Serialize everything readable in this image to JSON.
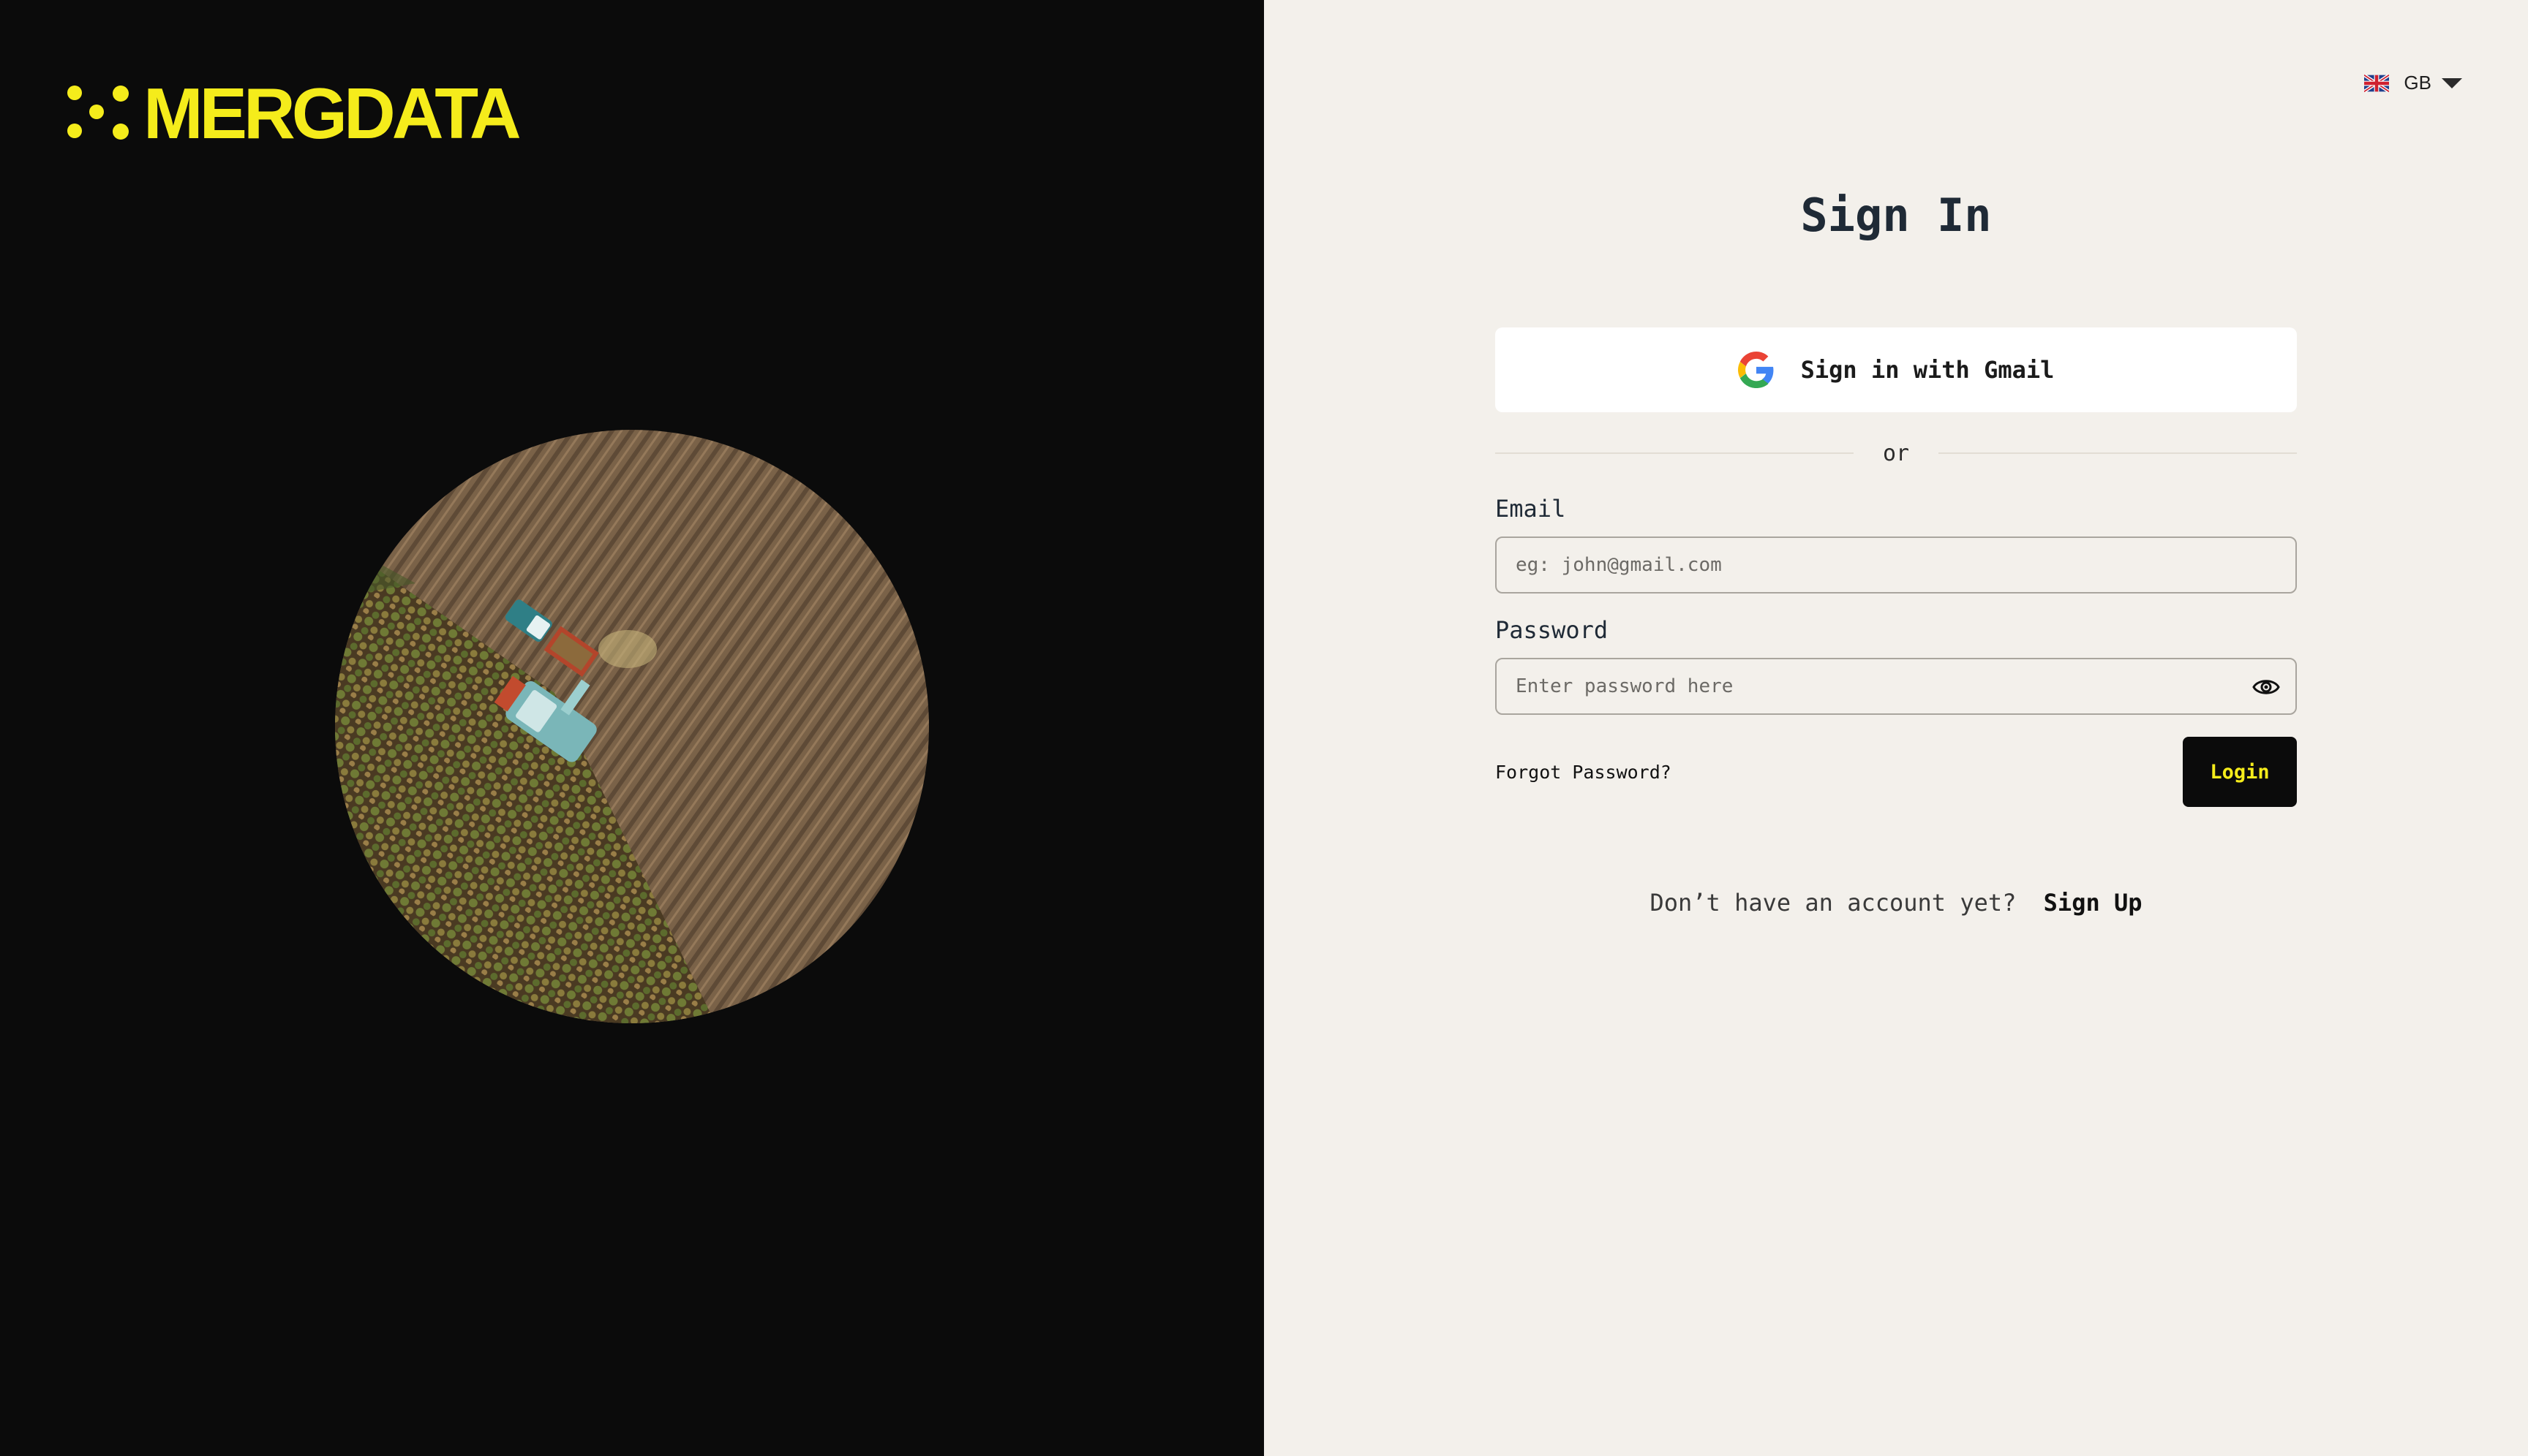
{
  "brand": {
    "name": "MERGDATA",
    "accent_color": "#f5ec1b",
    "logo_icon": "five-dots-logo-icon"
  },
  "hero": {
    "icon": "aerial-harvest-field-image"
  },
  "language": {
    "code": "GB",
    "flag_icon": "uk-flag-icon"
  },
  "signin": {
    "title": "Sign In",
    "gmail_button_label": "Sign in with Gmail",
    "divider_text": "or",
    "email": {
      "label": "Email",
      "placeholder": "eg: john@gmail.com",
      "value": ""
    },
    "password": {
      "label": "Password",
      "placeholder": "Enter password here",
      "value": ""
    },
    "forgot_password_label": "Forgot Password?",
    "login_button_label": "Login",
    "no_account_text": "Don’t have an account yet?",
    "signup_link_label": "Sign Up"
  }
}
